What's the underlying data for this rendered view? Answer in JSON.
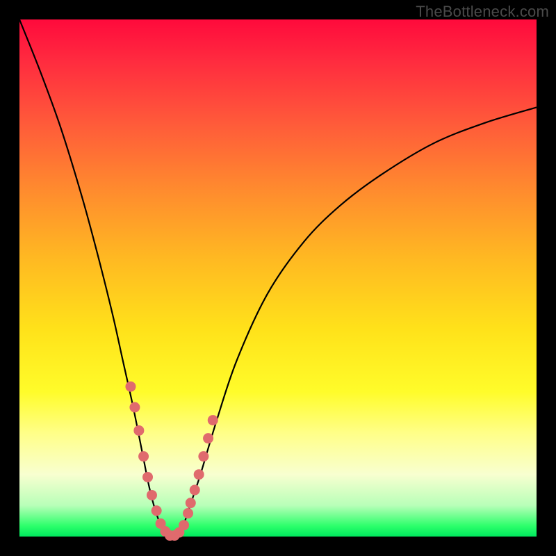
{
  "watermark": "TheBottleneck.com",
  "colors": {
    "gradient_top": "#ff0a3c",
    "gradient_bottom": "#00e85e",
    "curve": "#000000",
    "dots": "#e06a6d",
    "frame_border": "#000000"
  },
  "chart_data": {
    "type": "line",
    "title": "",
    "xlabel": "",
    "ylabel": "",
    "xlim": [
      0,
      100
    ],
    "ylim": [
      0,
      100
    ],
    "grid": false,
    "series": [
      {
        "name": "bottleneck-curve",
        "x": [
          0,
          4,
          8,
          12,
          15,
          18,
          20,
          22,
          24,
          25,
          26,
          27,
          28,
          29,
          30,
          31,
          32,
          33,
          35,
          38,
          42,
          48,
          55,
          62,
          70,
          80,
          90,
          100
        ],
        "values": [
          100,
          90,
          79,
          66,
          55,
          43,
          34,
          25,
          15,
          10,
          6,
          3,
          1,
          0,
          0,
          1,
          3,
          6,
          12,
          22,
          34,
          47,
          57,
          64,
          70,
          76,
          80,
          83
        ]
      }
    ],
    "markers": {
      "name": "highlighted-points",
      "x": [
        21.5,
        22.3,
        23.1,
        24.0,
        24.8,
        25.6,
        26.5,
        27.3,
        28.2,
        29.1,
        30.0,
        30.9,
        31.8,
        32.6,
        33.1,
        33.9,
        34.7,
        35.6,
        36.5,
        37.4
      ],
      "values": [
        29.0,
        25.0,
        20.5,
        15.5,
        11.5,
        8.0,
        5.0,
        2.5,
        1.0,
        0.2,
        0.2,
        0.8,
        2.2,
        4.5,
        6.5,
        9.0,
        12.0,
        15.5,
        19.0,
        22.5
      ]
    }
  }
}
